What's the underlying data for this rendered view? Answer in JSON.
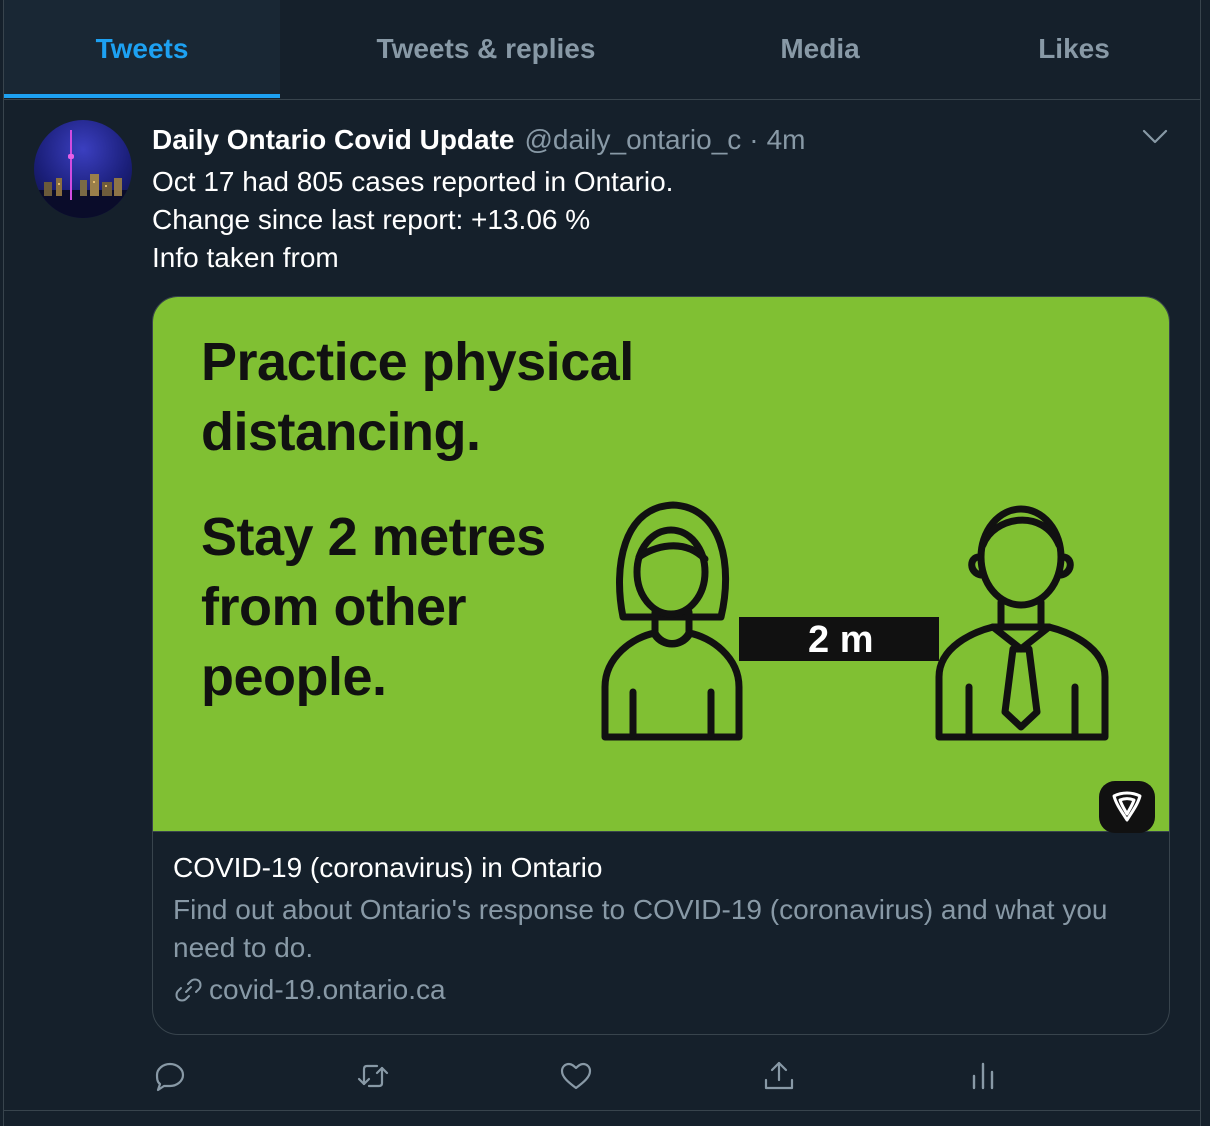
{
  "tabs": [
    {
      "label": "Tweets",
      "active": true
    },
    {
      "label": "Tweets & replies",
      "active": false
    },
    {
      "label": "Media",
      "active": false
    },
    {
      "label": "Likes",
      "active": false
    }
  ],
  "tweet": {
    "author_name": "Daily Ontario Covid Update",
    "handle": "@daily_ontario_c",
    "separator": "·",
    "time": "4m",
    "text_lines": [
      "Oct 17 had 805 cases reported in Ontario.",
      "Change since last report: +13.06 %",
      "Info taken from"
    ],
    "card": {
      "image": {
        "heading_lines": [
          "Practice physical",
          "distancing."
        ],
        "sub_lines": [
          "Stay 2 metres",
          "from other",
          "people."
        ],
        "distance_label": "2 m",
        "background": "#80c033"
      },
      "title": "COVID-19 (coronavirus) in Ontario",
      "description": "Find out about Ontario's response to COVID-19 (coronavirus) and what you need to do.",
      "link": "covid-19.ontario.ca"
    }
  },
  "actions": [
    "reply-icon",
    "retweet-icon",
    "like-icon",
    "share-icon",
    "analytics-icon"
  ],
  "colors": {
    "background": "#15202b",
    "accent": "#1da1f2",
    "secondary_text": "#8899a6",
    "border": "#38444d"
  }
}
